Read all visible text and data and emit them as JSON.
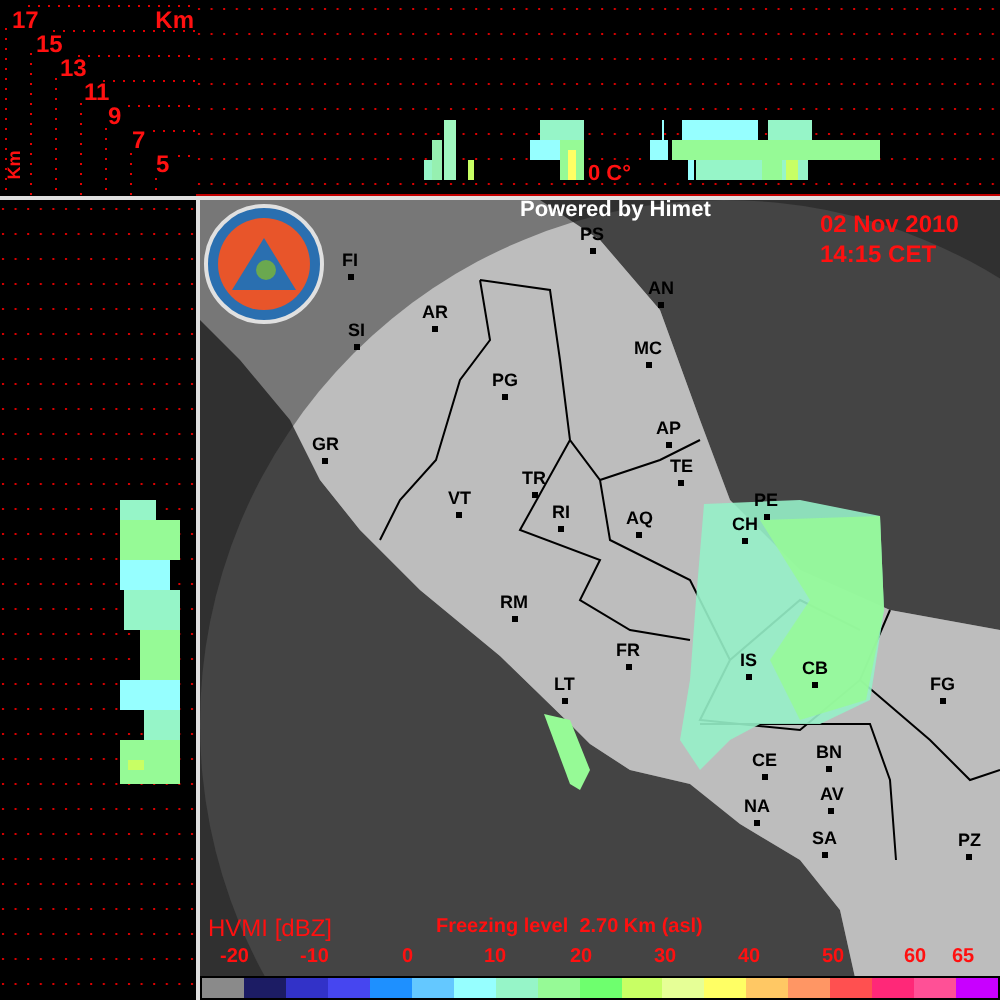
{
  "height_scale": {
    "unit": "Km",
    "levels": [
      "17",
      "15",
      "13",
      "11",
      "9",
      "7",
      "5"
    ],
    "side_unit": "Km"
  },
  "cross_section": {
    "freezing_mark": "0 C°"
  },
  "map": {
    "credit": "Powered by Himet",
    "date": "02 Nov 2010",
    "time": "14:15 CET",
    "cities": [
      "FI",
      "SI",
      "AR",
      "PG",
      "GR",
      "TR",
      "VT",
      "RI",
      "AQ",
      "TE",
      "AP",
      "MC",
      "AN",
      "PS",
      "PE",
      "CH",
      "RM",
      "FR",
      "LT",
      "IS",
      "CB",
      "FG",
      "CE",
      "BN",
      "NA",
      "AV",
      "SA",
      "PZ"
    ]
  },
  "legend": {
    "product": "HVMI [dBZ]",
    "freezing_level": "Freezing level  2.70 Km (asl)",
    "ticks": [
      "-20",
      "-10",
      "0",
      "10",
      "20",
      "30",
      "40",
      "50",
      "60",
      "65"
    ],
    "swatches": [
      {
        "color": "#8a8a8a"
      },
      {
        "color": "#1c1c64"
      },
      {
        "color": "#3232c8"
      },
      {
        "color": "#4646f0"
      },
      {
        "color": "#1e90ff"
      },
      {
        "color": "#64c8ff"
      },
      {
        "color": "#96ffff"
      },
      {
        "color": "#96f5c8"
      },
      {
        "color": "#96fa96"
      },
      {
        "color": "#6eff6e"
      },
      {
        "color": "#c8ff64"
      },
      {
        "color": "#e6ff96"
      },
      {
        "color": "#ffff64"
      },
      {
        "color": "#ffc864"
      },
      {
        "color": "#ff9664"
      },
      {
        "color": "#ff5050"
      },
      {
        "color": "#ff2878"
      },
      {
        "color": "#ff5096"
      },
      {
        "color": "#c800ff"
      }
    ]
  }
}
